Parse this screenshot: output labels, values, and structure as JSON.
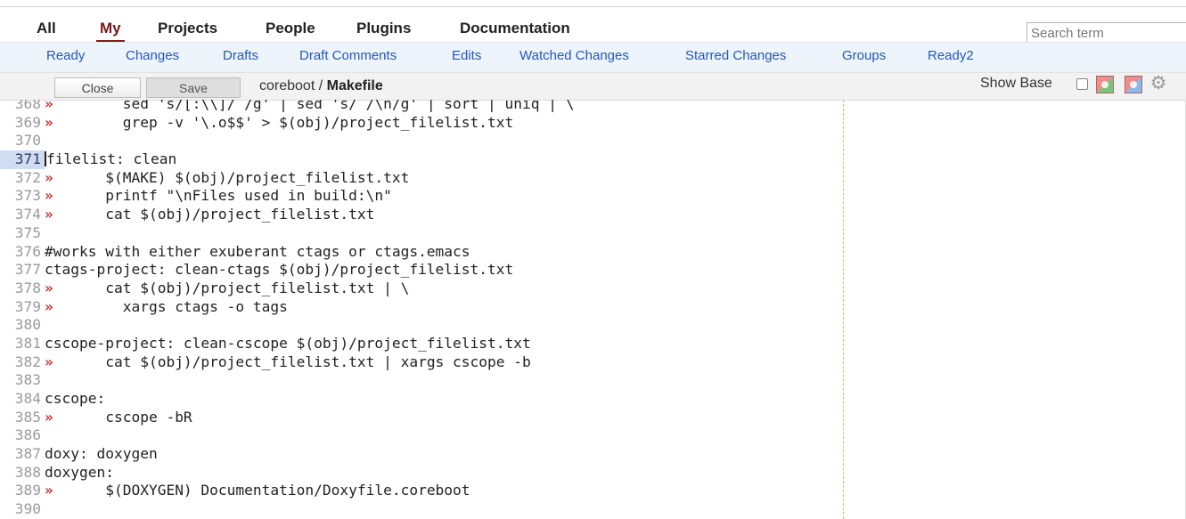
{
  "top_menu": [
    "All",
    "My",
    "Projects",
    "People",
    "Plugins",
    "Documentation"
  ],
  "top_menu_active": "My",
  "search": {
    "placeholder": "Search term"
  },
  "sub_menu": [
    "Ready",
    "Changes",
    "Drafts",
    "Draft Comments",
    "Edits",
    "Watched Changes",
    "Starred Changes",
    "Groups",
    "Ready2"
  ],
  "toolbar": {
    "close_label": "Close",
    "save_label": "Save",
    "project": "coreboot",
    "separator": " / ",
    "file": "Makefile",
    "show_base_label": "Show Base"
  },
  "icons": {
    "reload": "reload-icon",
    "diff": "diff-icon",
    "settings": "gear-icon"
  },
  "colors": {
    "accent_active": "#8b1c1c",
    "link": "#2458b8",
    "tab_marker": "#d42a2a",
    "current_line": "#cfdcf2"
  },
  "editor": {
    "tab_marker": "»",
    "current_line": 371,
    "lines": [
      {
        "n": "368",
        "tab": true,
        "code": "        sed 's/[:\\\\]/ /g' | sed 's/ /\\n/g' | sort | uniq | \\"
      },
      {
        "n": "369",
        "tab": true,
        "code": "        grep -v '\\.o$$' > $(obj)/project_filelist.txt"
      },
      {
        "n": "370",
        "tab": false,
        "code": ""
      },
      {
        "n": "371",
        "tab": false,
        "code": "filelist: clean"
      },
      {
        "n": "372",
        "tab": true,
        "code": "      $(MAKE) $(obj)/project_filelist.txt"
      },
      {
        "n": "373",
        "tab": true,
        "code": "      printf \"\\nFiles used in build:\\n\""
      },
      {
        "n": "374",
        "tab": true,
        "code": "      cat $(obj)/project_filelist.txt"
      },
      {
        "n": "375",
        "tab": false,
        "code": ""
      },
      {
        "n": "376",
        "tab": false,
        "code": "#works with either exuberant ctags or ctags.emacs"
      },
      {
        "n": "377",
        "tab": false,
        "code": "ctags-project: clean-ctags $(obj)/project_filelist.txt"
      },
      {
        "n": "378",
        "tab": true,
        "code": "      cat $(obj)/project_filelist.txt | \\"
      },
      {
        "n": "379",
        "tab": true,
        "code": "        xargs ctags -o tags"
      },
      {
        "n": "380",
        "tab": false,
        "code": ""
      },
      {
        "n": "381",
        "tab": false,
        "code": "cscope-project: clean-cscope $(obj)/project_filelist.txt"
      },
      {
        "n": "382",
        "tab": true,
        "code": "      cat $(obj)/project_filelist.txt | xargs cscope -b"
      },
      {
        "n": "383",
        "tab": false,
        "code": ""
      },
      {
        "n": "384",
        "tab": false,
        "code": "cscope:"
      },
      {
        "n": "385",
        "tab": true,
        "code": "      cscope -bR"
      },
      {
        "n": "386",
        "tab": false,
        "code": ""
      },
      {
        "n": "387",
        "tab": false,
        "code": "doxy: doxygen"
      },
      {
        "n": "388",
        "tab": false,
        "code": "doxygen:"
      },
      {
        "n": "389",
        "tab": true,
        "code": "      $(DOXYGEN) Documentation/Doxyfile.coreboot"
      },
      {
        "n": "390",
        "tab": false,
        "code": ""
      }
    ]
  }
}
